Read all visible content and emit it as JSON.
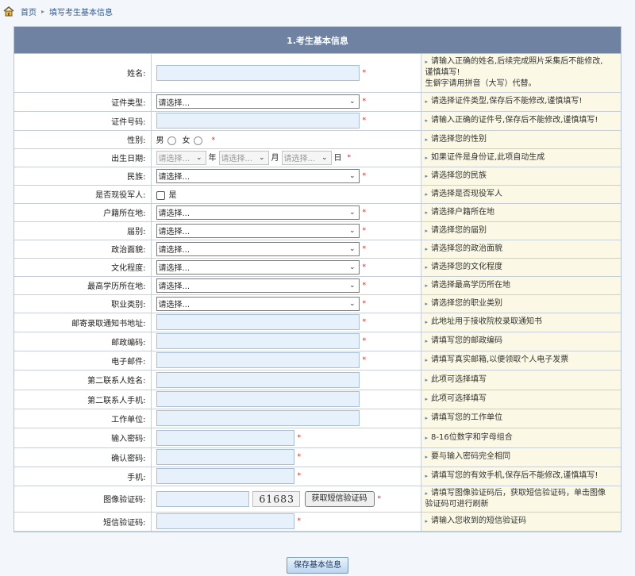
{
  "breadcrumb": {
    "home": "首页",
    "current": "填写考生基本信息"
  },
  "form": {
    "title": "1.考生基本信息",
    "rows": [
      {
        "label": "姓名:",
        "type": "text-long",
        "required": true,
        "tip": [
          "请输入正确的姓名,后续完成照片采集后不能修改,",
          "谨慎填写!",
          "生僻字请用拼音（大写）代替。"
        ]
      },
      {
        "label": "证件类型:",
        "type": "select",
        "value": "请选择...",
        "required": true,
        "tip": [
          "请选择证件类型,保存后不能修改,谨慎填写!"
        ]
      },
      {
        "label": "证件号码:",
        "type": "text-long",
        "required": true,
        "tip": [
          "请输入正确的证件号,保存后不能修改,谨慎填写!"
        ]
      },
      {
        "label": "性别:",
        "type": "radio",
        "options": [
          "男",
          "女"
        ],
        "required": true,
        "tip": [
          "请选择您的性别"
        ]
      },
      {
        "label": "出生日期:",
        "type": "date",
        "placeholder": "请选择...",
        "units": [
          "年",
          "月",
          "日"
        ],
        "required": true,
        "tip": [
          "如果证件是身份证,此项自动生成"
        ]
      },
      {
        "label": "民族:",
        "type": "select",
        "value": "请选择...",
        "required": true,
        "tip": [
          "请选择您的民族"
        ]
      },
      {
        "label": "是否现役军人:",
        "type": "checkbox",
        "option": "是",
        "required": false,
        "tip": [
          "请选择是否现役军人"
        ]
      },
      {
        "label": "户籍所在地:",
        "type": "select",
        "value": "请选择...",
        "required": true,
        "tip": [
          "请选择户籍所在地"
        ]
      },
      {
        "label": "届别:",
        "type": "select",
        "value": "请选择...",
        "required": true,
        "tip": [
          "请选择您的届别"
        ]
      },
      {
        "label": "政治面貌:",
        "type": "select",
        "value": "请选择...",
        "required": true,
        "tip": [
          "请选择您的政治面貌"
        ]
      },
      {
        "label": "文化程度:",
        "type": "select",
        "value": "请选择...",
        "required": true,
        "tip": [
          "请选择您的文化程度"
        ]
      },
      {
        "label": "最高学历所在地:",
        "type": "select",
        "value": "请选择...",
        "required": true,
        "tip": [
          "请选择最高学历所在地"
        ]
      },
      {
        "label": "职业类别:",
        "type": "select",
        "value": "请选择...",
        "required": true,
        "tip": [
          "请选择您的职业类别"
        ]
      },
      {
        "label": "邮寄录取通知书地址:",
        "type": "text-long",
        "required": true,
        "tip": [
          "此地址用于接收院校录取通知书"
        ]
      },
      {
        "label": "邮政编码:",
        "type": "text-long",
        "required": true,
        "tip": [
          "请填写您的邮政编码"
        ]
      },
      {
        "label": "电子邮件:",
        "type": "text-long",
        "required": true,
        "tip": [
          "请填写真实邮箱,以便领取个人电子发票"
        ]
      },
      {
        "label": "第二联系人姓名:",
        "type": "text-long",
        "required": false,
        "tip": [
          "此项可选择填写"
        ]
      },
      {
        "label": "第二联系人手机:",
        "type": "text-long",
        "required": false,
        "tip": [
          "此项可选择填写"
        ]
      },
      {
        "label": "工作单位:",
        "type": "text-long",
        "required": false,
        "tip": [
          "请填写您的工作单位"
        ]
      },
      {
        "label": "输入密码:",
        "type": "text-med",
        "required": true,
        "tip": [
          "8-16位数字和字母组合"
        ]
      },
      {
        "label": "确认密码:",
        "type": "text-med",
        "required": true,
        "tip": [
          "要与输入密码完全相同"
        ]
      },
      {
        "label": "手机:",
        "type": "text-med",
        "required": true,
        "tip": [
          "请填写您的有效手机,保存后不能修改,谨慎填写!"
        ]
      },
      {
        "label": "图像验证码:",
        "type": "captcha",
        "captcha_text": "61683",
        "button": "获取短信验证码",
        "required": true,
        "tip": [
          "请填写图像验证码后，获取短信验证码，单击图像",
          "验证码可进行刷新"
        ]
      },
      {
        "label": "短信验证码:",
        "type": "text-med",
        "required": true,
        "tip": [
          "请输入您收到的短信验证码"
        ]
      }
    ]
  },
  "save_button": "保存基本信息"
}
